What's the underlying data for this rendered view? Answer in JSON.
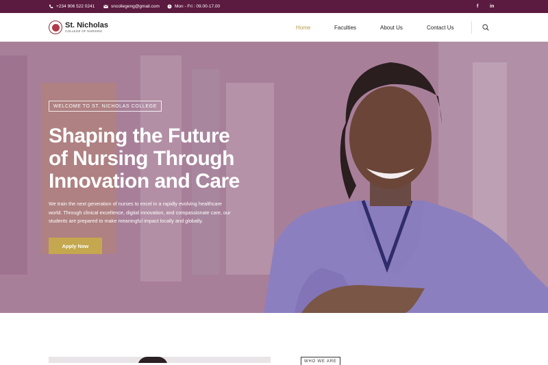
{
  "topbar": {
    "phone": "+234 906 522 0241",
    "email": "sncollegeng@gmail.com",
    "hours": "Mon - Fri : 09.00-17.00",
    "social": {
      "facebook": "f",
      "linkedin": "in"
    }
  },
  "header": {
    "logo_name": "St. Nicholas",
    "logo_sub": "COLLEGE OF NURSING",
    "nav": [
      "Home",
      "Faculties",
      "About Us",
      "Contact Us"
    ],
    "active_nav": "Home"
  },
  "hero": {
    "badge": "WELCOME TO ST. NICHOLAS COLLEGE",
    "title_line1": "Shaping the Future",
    "title_line2": "of Nursing Through",
    "title_line3": "Innovation and Care",
    "body_line1": "We train the next generation of nurses to excel in a rapidly evolving healthcare",
    "body_line2": "world. Through clinical excellence, digital innovation, and compassionate care, our",
    "body_line3": "students are prepared to make meaningful impact locally and globally.",
    "cta": "Apply Now"
  },
  "section": {
    "who_label": "WHO WE ARE"
  },
  "colors": {
    "topbar": "#5b1a3f",
    "accent": "#c4a74e",
    "hero_overlay": "#a47995"
  }
}
